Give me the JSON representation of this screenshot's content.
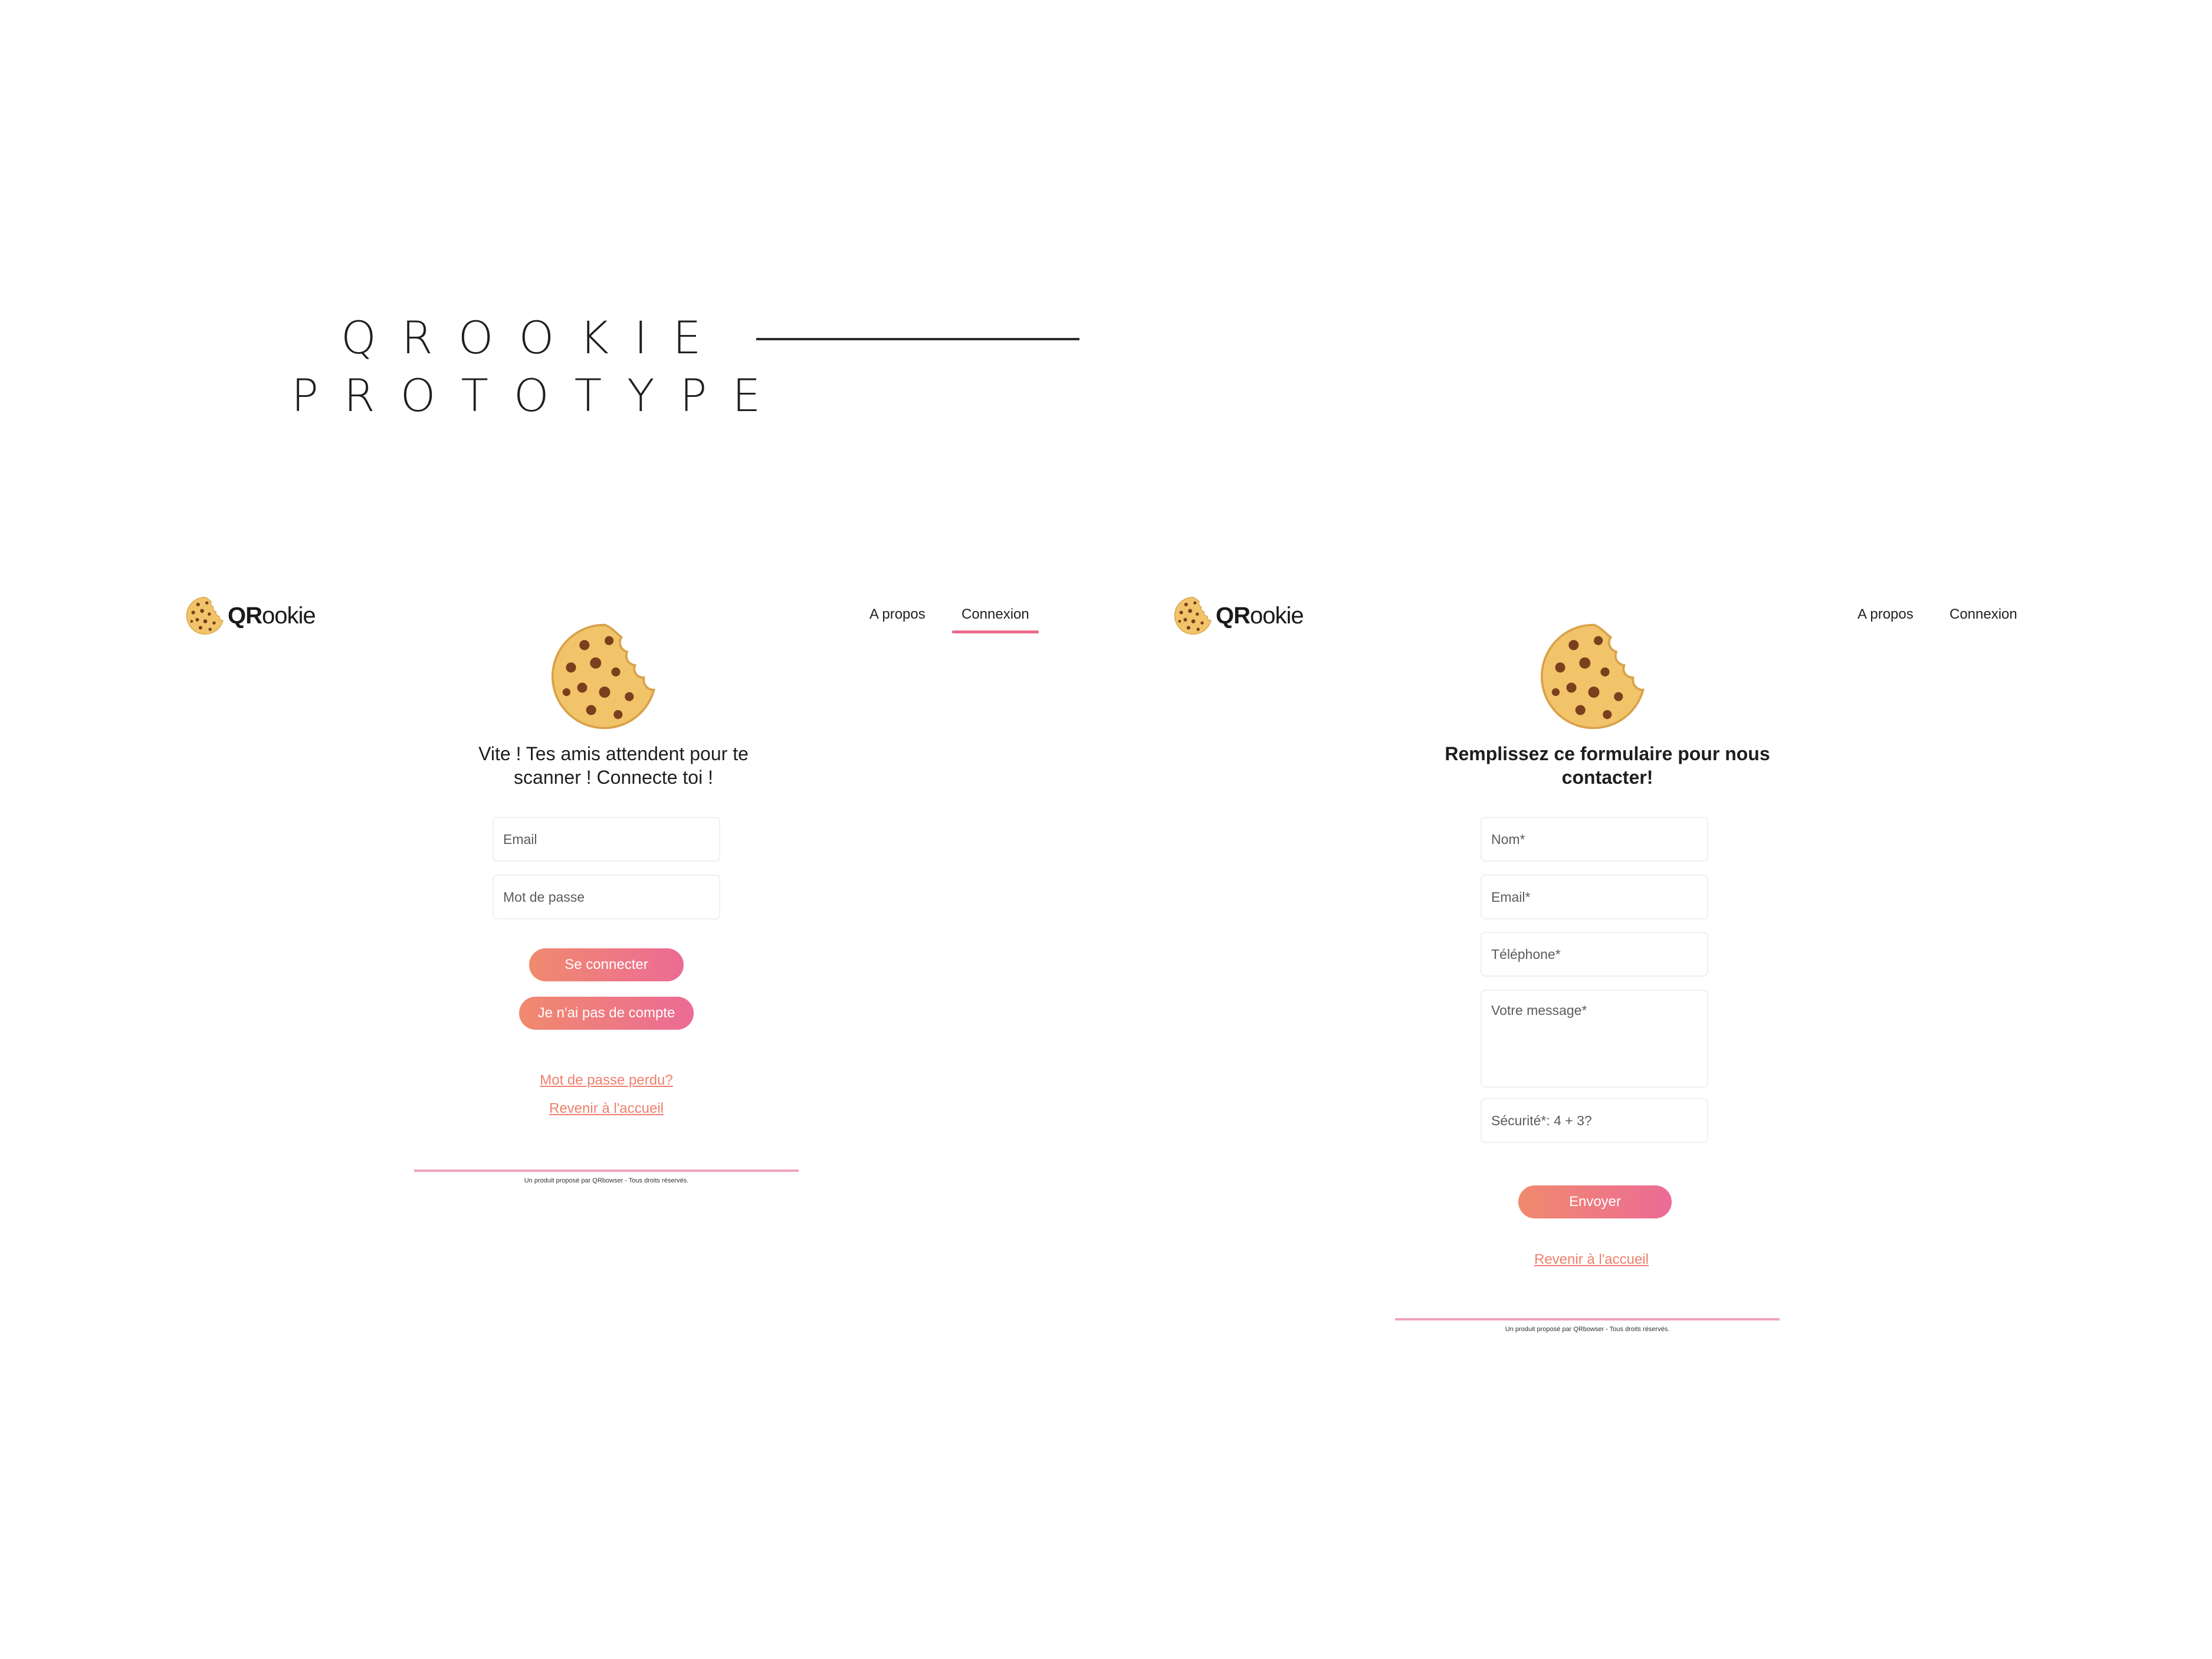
{
  "title": {
    "line1": "QROOKIE",
    "line2": "PROTOTYPE"
  },
  "brand": {
    "logo_text_bold": "QR",
    "logo_text_rest": "ookie",
    "accent_color": "#ea6b8c",
    "link_color": "#ef7f6d",
    "button_gradient": [
      "#f08a6e",
      "#ec6b95"
    ]
  },
  "login_screen": {
    "nav": {
      "about": "A propos",
      "login": "Connexion",
      "active": "Connexion"
    },
    "headline": "Vite ! Tes amis attendent pour te scanner ! Connecte toi !",
    "email_placeholder": "Email",
    "password_placeholder": "Mot de passe",
    "connect_button": "Se connecter",
    "no_account_button": "Je n'ai pas de compte",
    "forgot_password_link": "Mot de passe perdu?",
    "home_link": "Revenir à l'accueil",
    "footer": "Un produit proposé par QRbowser - Tous droits réservés."
  },
  "contact_screen": {
    "nav": {
      "about": "A propos",
      "login": "Connexion"
    },
    "headline": "Remplissez ce formulaire pour nous contacter!",
    "name_placeholder": "Nom*",
    "email_placeholder": "Email*",
    "phone_placeholder": "Téléphone*",
    "message_placeholder": "Votre message*",
    "security_placeholder": "Sécurité*: 4 + 3?",
    "send_button": "Envoyer",
    "home_link": "Revenir à l'accueil",
    "footer": "Un produit proposé par QRbowser - Tous droits réservés."
  },
  "icons": {
    "logo": "cookie-icon",
    "hero": "bitten-cookie-icon"
  }
}
